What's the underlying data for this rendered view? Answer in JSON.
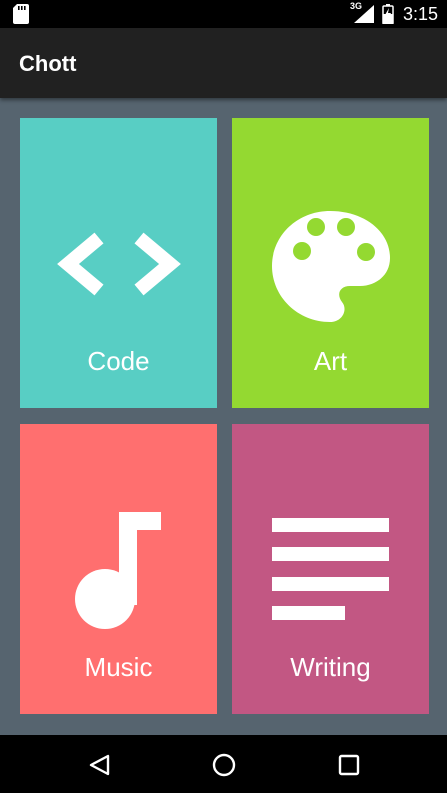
{
  "status_bar": {
    "network": "3G",
    "time": "3:15",
    "icons": [
      "sd-card-icon",
      "signal-icon",
      "battery-charging-icon"
    ]
  },
  "app_bar": {
    "title": "Chott"
  },
  "categories": [
    {
      "label": "Code",
      "icon": "code-icon",
      "color": "#58cec4"
    },
    {
      "label": "Art",
      "icon": "palette-icon",
      "color": "#94d931"
    },
    {
      "label": "Music",
      "icon": "music-note-icon",
      "color": "#ff6f6f"
    },
    {
      "label": "Writing",
      "icon": "text-lines-icon",
      "color": "#c25783"
    }
  ],
  "nav_bar": {
    "icons": [
      "back-icon",
      "home-icon",
      "recents-icon"
    ]
  }
}
